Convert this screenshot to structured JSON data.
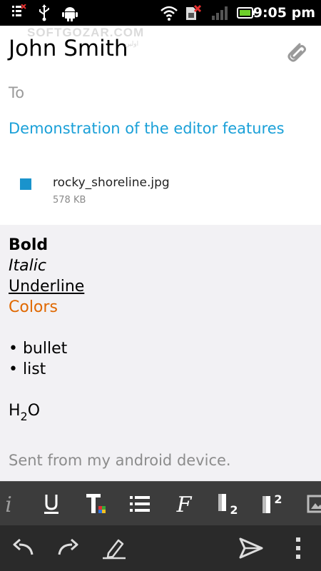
{
  "status_bar": {
    "time": "9:05 pm",
    "icons": [
      "notification-list-icon",
      "usb-icon",
      "android-debug-icon",
      "wifi-icon",
      "sim-error-icon",
      "signal-icon",
      "battery-icon"
    ]
  },
  "watermark": {
    "text": "SOFTGOZAR.COM",
    "sub": "اولین"
  },
  "compose": {
    "from_name": "John Smith",
    "to_placeholder": "To",
    "subject": "Demonstration of the editor features",
    "attachment": {
      "file_name": "rocky_shoreline.jpg",
      "file_size": "578 KB"
    }
  },
  "body": {
    "bold": "Bold",
    "italic": "Italic",
    "underline": "Underline",
    "colors": "Colors",
    "bullet1": "• bullet",
    "bullet2": "• list",
    "formula_base": "H",
    "formula_sub": "2",
    "formula_end": "O",
    "signature": "Sent from my android device."
  },
  "colors": {
    "subject": "#1aa0d8",
    "colors_text": "#e06800",
    "format_bar": "#3c3c3c",
    "action_bar": "#2a2a2a"
  },
  "format_toolbar": [
    "italic-icon",
    "underline-icon",
    "text-color-icon",
    "bullet-list-icon",
    "font-icon",
    "subscript-icon",
    "superscript-icon",
    "insert-image-icon"
  ],
  "action_toolbar": [
    "undo-icon",
    "redo-icon",
    "pen-icon",
    "send-icon",
    "overflow-menu-icon"
  ]
}
